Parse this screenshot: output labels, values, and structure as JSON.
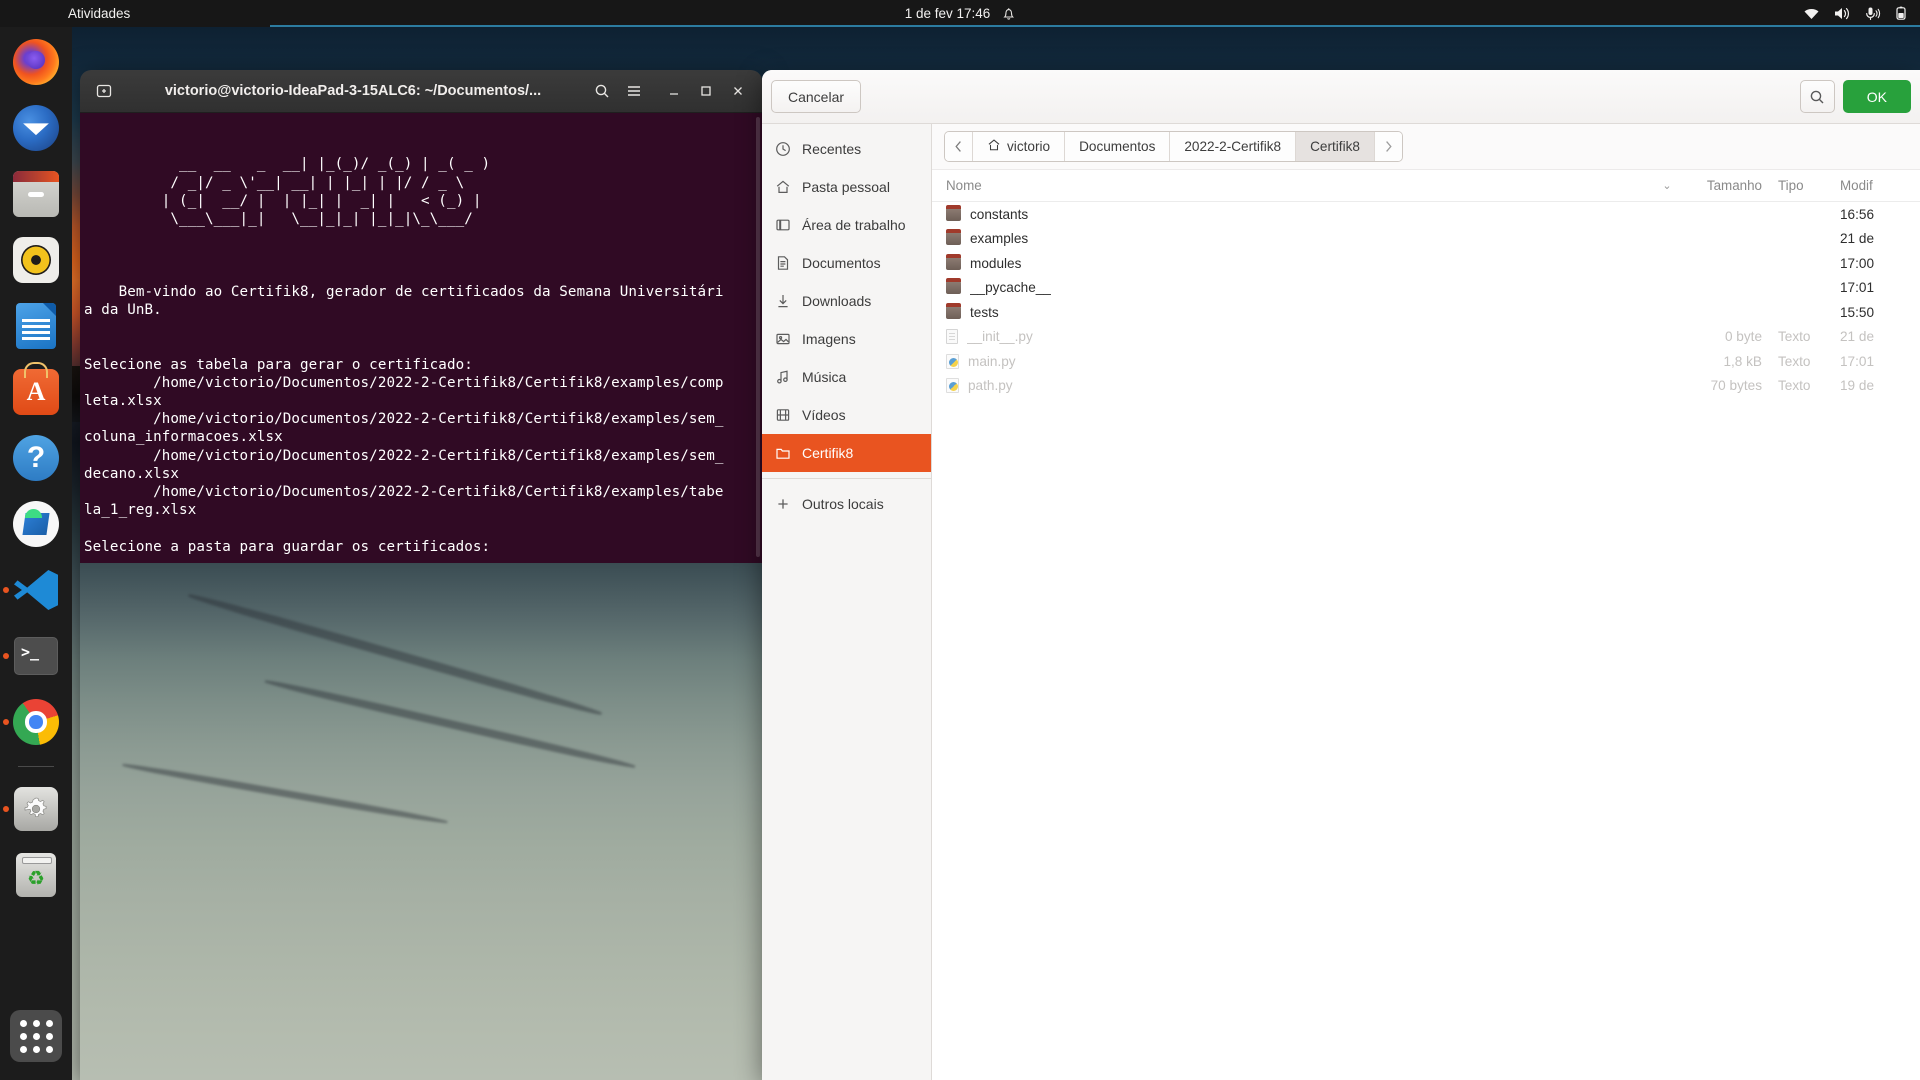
{
  "topbar": {
    "activities": "Atividades",
    "clock": "1 de fev  17:46",
    "bell_icon": "bell-icon",
    "wifi_icon": "wifi-icon",
    "volume_icon": "volume-icon",
    "microphone_icon": "microphone-icon",
    "battery_icon": "battery-icon"
  },
  "dock": {
    "items": [
      {
        "name": "firefox",
        "label": "Firefox",
        "running": false
      },
      {
        "name": "thunderbird",
        "label": "Thunderbird",
        "running": false
      },
      {
        "name": "files",
        "label": "Arquivos",
        "running": false
      },
      {
        "name": "rhythmbox",
        "label": "Rhythmbox",
        "running": false
      },
      {
        "name": "libreoffice-writer",
        "label": "LibreOffice Writer",
        "running": false
      },
      {
        "name": "ubuntu-software",
        "label": "Ubuntu Software",
        "running": false
      },
      {
        "name": "help",
        "label": "Ajuda",
        "running": false
      },
      {
        "name": "android-studio",
        "label": "Android Studio",
        "running": false
      },
      {
        "name": "vscode",
        "label": "Visual Studio Code",
        "running": true
      },
      {
        "name": "terminal",
        "label": "Terminal",
        "running": true
      },
      {
        "name": "chrome",
        "label": "Google Chrome",
        "running": true
      },
      {
        "name": "settings",
        "label": "Configurações",
        "running": true
      },
      {
        "name": "trash",
        "label": "Lixeira",
        "running": false
      }
    ],
    "show_apps_label": "Mostrar aplicativos"
  },
  "terminal": {
    "title": "victorio@victorio-IdeaPad-3-15ALC6: ~/Documentos/...",
    "new_tab_icon": "new-tab-icon",
    "search_icon": "search-icon",
    "menu_icon": "hamburger-menu-icon",
    "minimize_icon": "minimize-icon",
    "maximize_icon": "maximize-icon",
    "close_icon": "close-icon",
    "ascii_art": [
      "           __  __   _  __| |_(_)/ _(_) | _( _ )",
      "          / _|/ _ \\'__| __| | |_| | |/ / _ \\",
      "         | (_|  __/ |  | |_| |  _| |   < (_) |",
      "          \\___\\___|_|   \\__|_|_| |_|_|\\_\\___/"
    ],
    "lines": [
      "",
      "    Bem-vindo ao Certifik8, gerador de certificados da Semana Universitári",
      "a da UnB.",
      "",
      "",
      "Selecione as tabela para gerar o certificado:",
      "        /home/victorio/Documentos/2022-2-Certifik8/Certifik8/examples/comp",
      "leta.xlsx",
      "        /home/victorio/Documentos/2022-2-Certifik8/Certifik8/examples/sem_",
      "coluna_informacoes.xlsx",
      "        /home/victorio/Documentos/2022-2-Certifik8/Certifik8/examples/sem_",
      "decano.xlsx",
      "        /home/victorio/Documentos/2022-2-Certifik8/Certifik8/examples/tabe",
      "la_1_reg.xlsx",
      "",
      "Selecione a pasta para guardar os certificados:"
    ],
    "background_color": "#300a24",
    "text_color": "#ffffff"
  },
  "filedialog": {
    "cancel_label": "Cancelar",
    "ok_label": "OK",
    "search_icon": "search-icon",
    "ok_color": "#28a13c",
    "sidebar": {
      "items": [
        {
          "label": "Recentes",
          "icon": "clock-icon",
          "active": false
        },
        {
          "label": "Pasta pessoal",
          "icon": "home-icon",
          "active": false
        },
        {
          "label": "Área de trabalho",
          "icon": "desktop-icon",
          "active": false
        },
        {
          "label": "Documentos",
          "icon": "document-icon",
          "active": false
        },
        {
          "label": "Downloads",
          "icon": "download-icon",
          "active": false
        },
        {
          "label": "Imagens",
          "icon": "image-icon",
          "active": false
        },
        {
          "label": "Música",
          "icon": "music-note-icon",
          "active": false
        },
        {
          "label": "Vídeos",
          "icon": "film-icon",
          "active": false
        },
        {
          "label": "Certifik8",
          "icon": "folder-icon",
          "active": true
        }
      ],
      "other_locations": {
        "label": "Outros locais",
        "icon": "plus-icon"
      },
      "active_color": "#e95420"
    },
    "breadcrumb": {
      "back_icon": "chevron-left-icon",
      "forward_icon": "chevron-right-icon",
      "home_icon": "home-icon",
      "items": [
        {
          "label": "victorio",
          "current": false
        },
        {
          "label": "Documentos",
          "current": false
        },
        {
          "label": "2022-2-Certifik8",
          "current": false
        },
        {
          "label": "Certifik8",
          "current": true
        }
      ]
    },
    "columns": {
      "name": "Nome",
      "sort_icon": "chevron-down-icon",
      "size": "Tamanho",
      "type": "Tipo",
      "modified": "Modif"
    },
    "rows": [
      {
        "name": "constants",
        "icon": "folder-icon",
        "size": "",
        "type": "",
        "modified": "16:56",
        "dim": false
      },
      {
        "name": "examples",
        "icon": "folder-icon",
        "size": "",
        "type": "",
        "modified": "21 de",
        "dim": false
      },
      {
        "name": "modules",
        "icon": "folder-icon",
        "size": "",
        "type": "",
        "modified": "17:00",
        "dim": false
      },
      {
        "name": "__pycache__",
        "icon": "folder-icon",
        "size": "",
        "type": "",
        "modified": "17:01",
        "dim": false
      },
      {
        "name": "tests",
        "icon": "folder-icon",
        "size": "",
        "type": "",
        "modified": "15:50",
        "dim": false
      },
      {
        "name": "__init__.py",
        "icon": "text-file-icon",
        "size": "0 byte",
        "type": "Texto",
        "modified": "21 de",
        "dim": true
      },
      {
        "name": "main.py",
        "icon": "python-file-icon",
        "size": "1,8 kB",
        "type": "Texto",
        "modified": "17:01",
        "dim": true
      },
      {
        "name": "path.py",
        "icon": "python-file-icon",
        "size": "70 bytes",
        "type": "Texto",
        "modified": "19 de",
        "dim": true
      }
    ]
  }
}
